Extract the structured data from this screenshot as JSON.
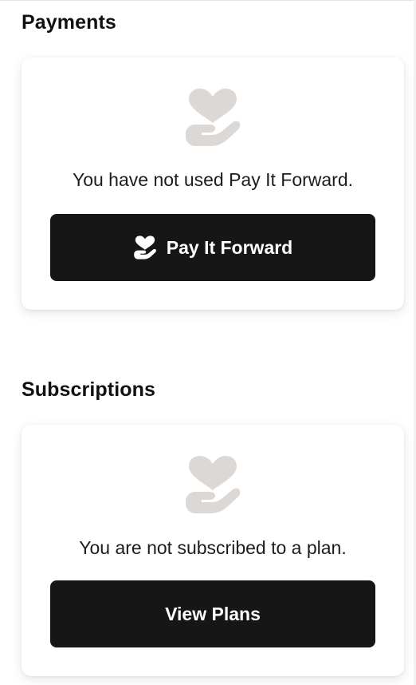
{
  "payments": {
    "title": "Payments",
    "empty_icon": "heart-in-hand-icon",
    "empty_message": "You have not used Pay It Forward.",
    "button_icon": "heart-in-hand-icon",
    "button_label": "Pay It Forward"
  },
  "subscriptions": {
    "title": "Subscriptions",
    "empty_icon": "heart-in-hand-icon",
    "empty_message": "You are not subscribed to a plan.",
    "button_label": "View Plans"
  },
  "colors": {
    "icon_gray": "#dcd8d6",
    "button_bg": "#161616",
    "button_text": "#ffffff"
  }
}
